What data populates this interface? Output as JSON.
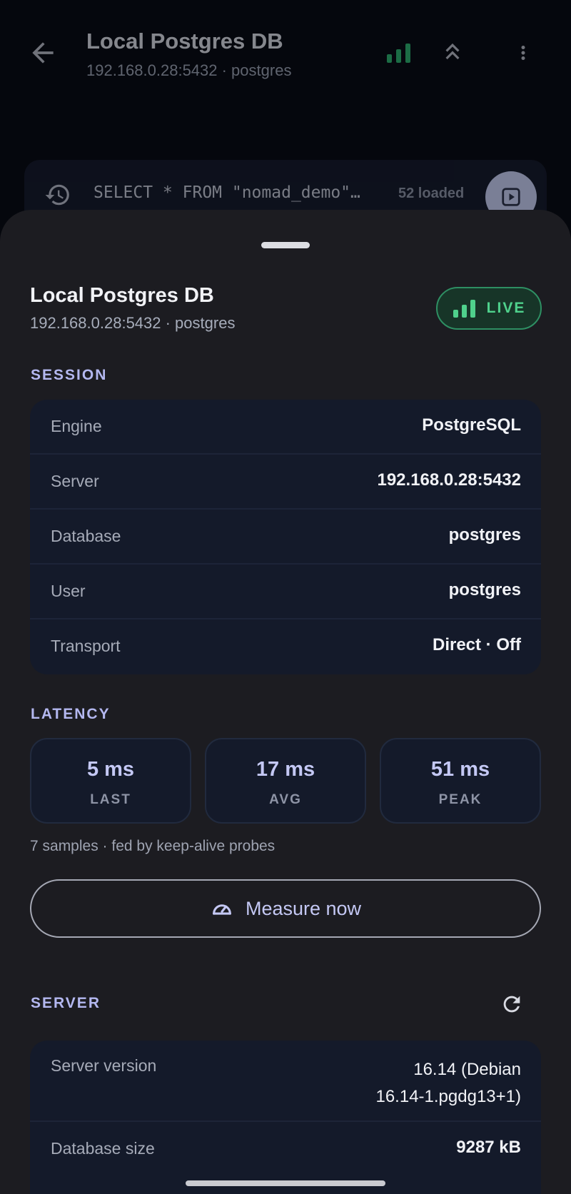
{
  "appbar": {
    "title": "Local Postgres DB",
    "subtitle": "192.168.0.28:5432 · postgres"
  },
  "query_bar": {
    "query": "SELECT * FROM \"nomad_demo\"…",
    "loaded_count": "52 loaded"
  },
  "sheet": {
    "title": "Local Postgres DB",
    "subtitle": "192.168.0.28:5432 · postgres",
    "status_badge": "LIVE",
    "session": {
      "heading": "SESSION",
      "rows": [
        {
          "label": "Engine",
          "value": "PostgreSQL"
        },
        {
          "label": "Server",
          "value": "192.168.0.28:5432"
        },
        {
          "label": "Database",
          "value": "postgres"
        },
        {
          "label": "User",
          "value": "postgres"
        },
        {
          "label": "Transport",
          "value": "Direct · Off"
        }
      ]
    },
    "latency": {
      "heading": "LATENCY",
      "stats": [
        {
          "value": "5 ms",
          "label": "LAST"
        },
        {
          "value": "17 ms",
          "label": "AVG"
        },
        {
          "value": "51 ms",
          "label": "PEAK"
        }
      ],
      "note": "7 samples · fed by keep-alive probes",
      "measure_label": "Measure now"
    },
    "server": {
      "heading": "SERVER",
      "version_label": "Server version",
      "version_line1": "16.14 (Debian",
      "version_line2": "16.14-1.pgdg13+1)",
      "size_label": "Database size",
      "size_value": "9287 kB"
    }
  },
  "colors": {
    "accent": "#c4c8f4",
    "live_green": "#4fd18c",
    "card_bg": "#141a2a",
    "sheet_bg": "#1c1c21"
  },
  "icons": [
    "arrow-back-icon",
    "signal-bars-icon",
    "double-chevron-up-icon",
    "more-vert-icon",
    "history-icon",
    "run-query-icon",
    "speedometer-icon",
    "refresh-icon"
  ]
}
